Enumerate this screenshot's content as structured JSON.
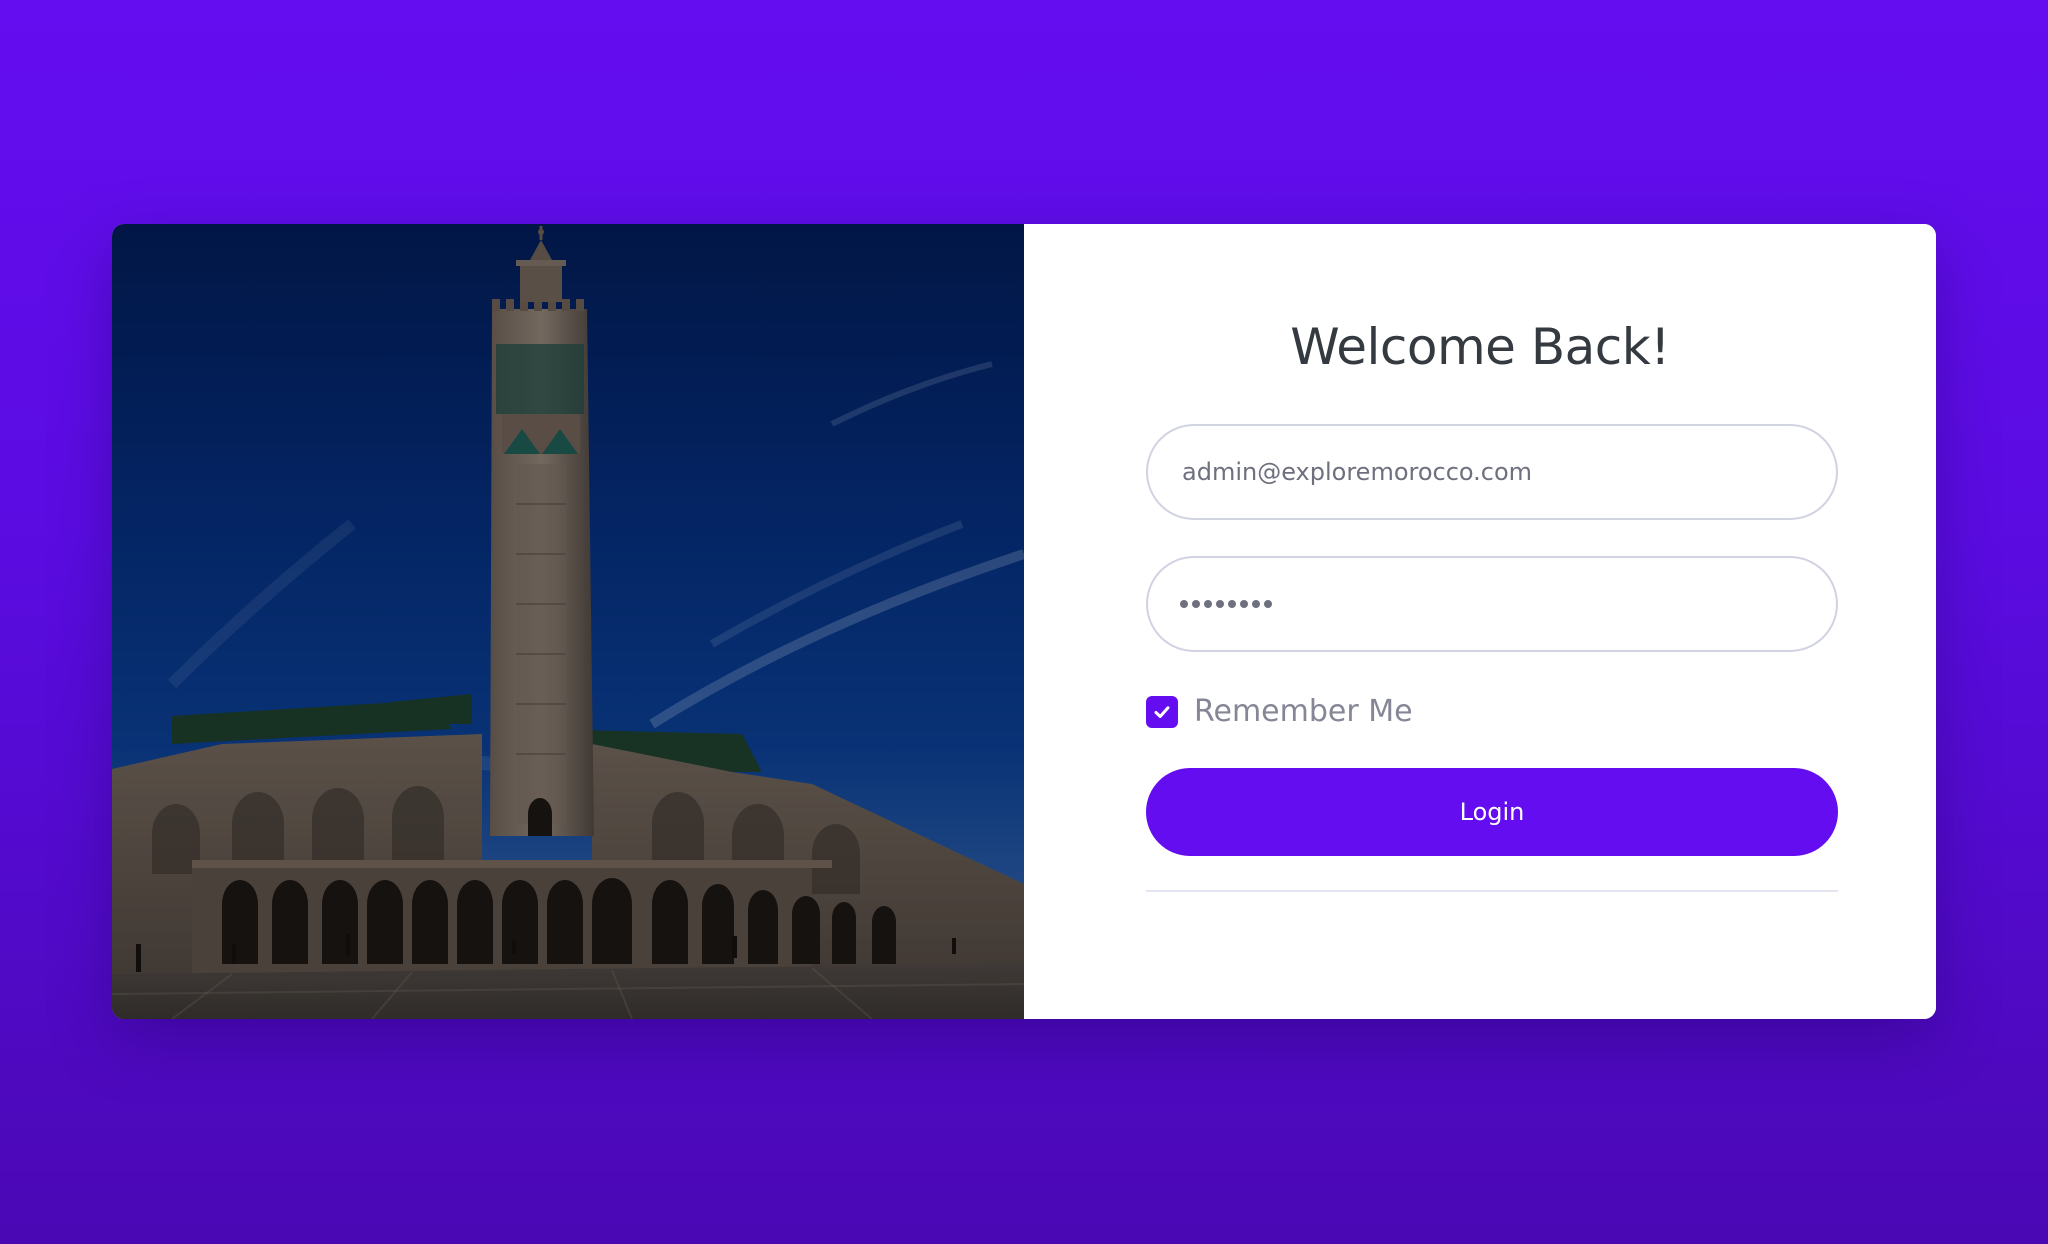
{
  "login": {
    "title": "Welcome Back!",
    "email_value": "admin@exploremorocco.com",
    "password_length": 8,
    "remember_label": "Remember Me",
    "remember_checked": true,
    "login_label": "Login"
  },
  "colors": {
    "accent": "#640df0",
    "background_top": "#640df0",
    "background_bottom": "#4a08b4",
    "text_dark": "#343a40",
    "text_muted": "#858796",
    "input_border": "#d1d3e2"
  },
  "icons": {
    "checkbox": "check-icon"
  }
}
